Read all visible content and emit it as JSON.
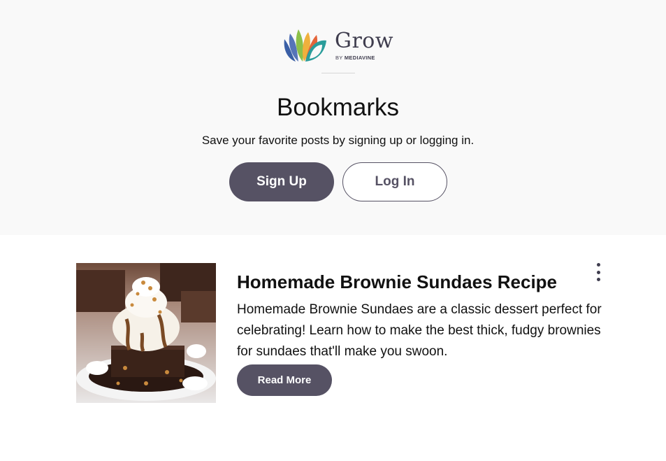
{
  "header": {
    "logo": {
      "wordmark": "Grow",
      "byline_prefix": "BY",
      "byline_brand": "MEDIAVINE"
    },
    "title": "Bookmarks",
    "subtitle": "Save your favorite posts by signing up or logging in.",
    "signup_label": "Sign Up",
    "login_label": "Log In"
  },
  "bookmarks": [
    {
      "title": "Homemade Brownie Sundaes Recipe",
      "description": "Homemade Brownie Sundaes are a classic dessert perfect for celebrating! Learn how to make the best thick, fudgy brownies for sundaes that'll make you swoon.",
      "read_more_label": "Read More",
      "image": "brownie-sundae-photo"
    }
  ],
  "colors": {
    "primary_button": "#565264",
    "hero_background": "#f9f9f9",
    "logo_blue": "#3a5fa6",
    "logo_teal": "#2a9d9b",
    "logo_green": "#8cc04a"
  }
}
